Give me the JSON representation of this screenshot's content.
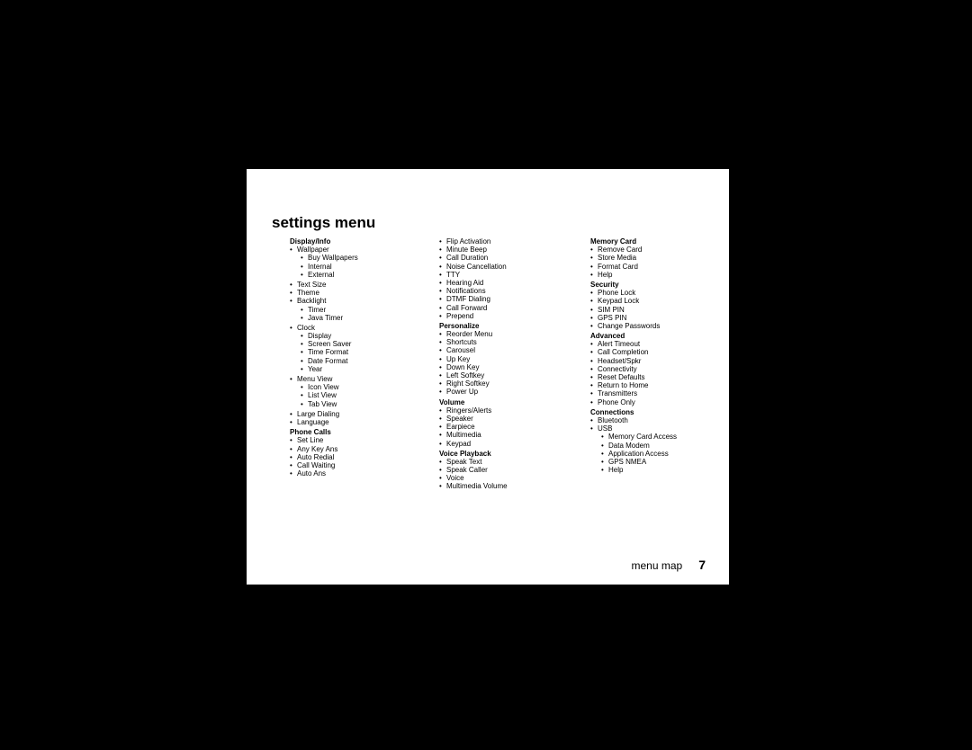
{
  "title": "settings menu",
  "footer": {
    "label": "menu map",
    "page": "7"
  },
  "col1": [
    {
      "head": "Display/Info",
      "items": [
        {
          "label": "Wallpaper",
          "children": [
            {
              "label": "Buy Wallpapers"
            },
            {
              "label": "Internal"
            },
            {
              "label": "External"
            }
          ]
        },
        {
          "label": "Text Size"
        },
        {
          "label": "Theme"
        },
        {
          "label": "Backlight",
          "children": [
            {
              "label": "Timer"
            },
            {
              "label": "Java Timer"
            }
          ]
        },
        {
          "label": "Clock",
          "children": [
            {
              "label": "Display"
            },
            {
              "label": "Screen Saver"
            },
            {
              "label": "Time Format"
            },
            {
              "label": "Date Format"
            },
            {
              "label": "Year"
            }
          ]
        },
        {
          "label": "Menu View",
          "children": [
            {
              "label": "Icon View"
            },
            {
              "label": "List View"
            },
            {
              "label": "Tab View"
            }
          ]
        },
        {
          "label": "Large Dialing"
        },
        {
          "label": "Language"
        }
      ]
    },
    {
      "head": "Phone Calls",
      "items": [
        {
          "label": "Set Line"
        },
        {
          "label": "Any Key Ans"
        },
        {
          "label": "Auto Redial"
        },
        {
          "label": "Call Waiting"
        },
        {
          "label": "Auto Ans"
        }
      ]
    }
  ],
  "col2_lead": [
    {
      "label": "Flip Activation"
    },
    {
      "label": "Minute Beep"
    },
    {
      "label": "Call Duration"
    },
    {
      "label": "Noise Cancellation"
    },
    {
      "label": "TTY"
    },
    {
      "label": "Hearing Aid"
    },
    {
      "label": "Notifications"
    },
    {
      "label": "DTMF Dialing"
    },
    {
      "label": "Call Forward"
    },
    {
      "label": "Prepend"
    }
  ],
  "col2": [
    {
      "head": "Personalize",
      "items": [
        {
          "label": "Reorder Menu"
        },
        {
          "label": "Shortcuts"
        },
        {
          "label": "Carousel"
        },
        {
          "label": "Up Key"
        },
        {
          "label": "Down Key"
        },
        {
          "label": "Left Softkey"
        },
        {
          "label": "Right Softkey"
        },
        {
          "label": "Power Up"
        }
      ]
    },
    {
      "head": "Volume",
      "items": [
        {
          "label": "Ringers/Alerts"
        },
        {
          "label": "Speaker"
        },
        {
          "label": "Earpiece"
        },
        {
          "label": "Multimedia"
        },
        {
          "label": "Keypad"
        }
      ]
    },
    {
      "head": "Voice Playback",
      "items": [
        {
          "label": "Speak Text"
        },
        {
          "label": "Speak Caller"
        },
        {
          "label": "Voice"
        },
        {
          "label": "Multimedia Volume"
        }
      ]
    }
  ],
  "col3": [
    {
      "head": "Memory Card",
      "items": [
        {
          "label": "Remove Card"
        },
        {
          "label": "Store Media"
        },
        {
          "label": "Format Card"
        },
        {
          "label": "Help"
        }
      ]
    },
    {
      "head": "Security",
      "items": [
        {
          "label": "Phone Lock"
        },
        {
          "label": "Keypad Lock"
        },
        {
          "label": "SIM PIN"
        },
        {
          "label": "GPS PIN"
        },
        {
          "label": "Change Passwords"
        }
      ]
    },
    {
      "head": "Advanced",
      "items": [
        {
          "label": "Alert Timeout"
        },
        {
          "label": "Call Completion"
        },
        {
          "label": "Headset/Spkr"
        },
        {
          "label": "Connectivity"
        },
        {
          "label": "Reset Defaults"
        },
        {
          "label": "Return to Home"
        },
        {
          "label": "Transmitters"
        },
        {
          "label": "Phone Only"
        }
      ]
    },
    {
      "head": "Connections",
      "items": [
        {
          "label": "Bluetooth"
        },
        {
          "label": "USB",
          "children": [
            {
              "label": "Memory Card Access"
            },
            {
              "label": "Data Modem"
            },
            {
              "label": "Application Access"
            },
            {
              "label": "GPS NMEA"
            },
            {
              "label": "Help"
            }
          ]
        }
      ]
    }
  ]
}
